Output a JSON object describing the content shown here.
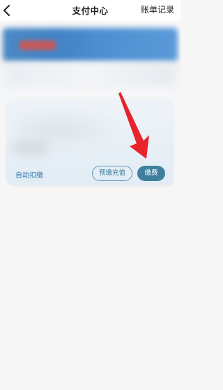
{
  "header": {
    "title": "支付中心",
    "records_label": "账单记录",
    "back_icon": "chevron-left-icon"
  },
  "card": {
    "auto_pay_label": "自动扣缴",
    "prepay_label": "预缴充值",
    "pay_label": "缴费"
  },
  "colors": {
    "accent": "#3e7f9e",
    "annotation_arrow": "#e8232a"
  }
}
